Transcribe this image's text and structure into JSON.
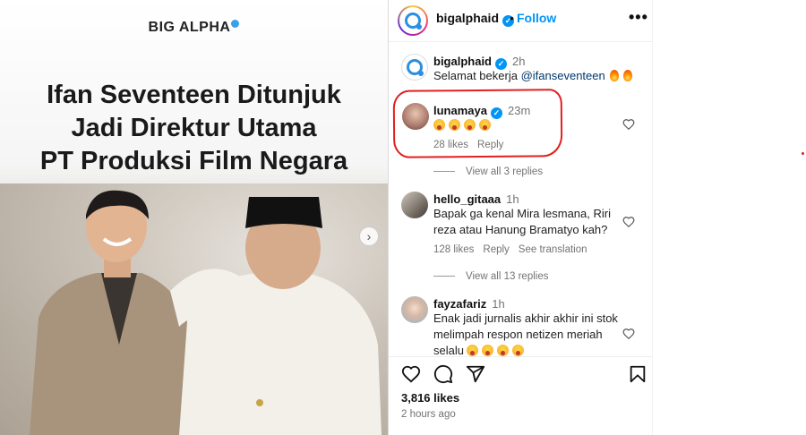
{
  "post_image": {
    "brand": "BIG ALPHA",
    "headline_lines": [
      "Ifan Seventeen Ditunjuk",
      "Jadi Direktur Utama",
      "PT Produksi Film Negara"
    ]
  },
  "header": {
    "username": "bigalphaid",
    "separator": "•",
    "follow_label": "Follow",
    "more_label": "•••"
  },
  "caption": {
    "username": "bigalphaid",
    "time": "2h",
    "text": "Selamat bekerja",
    "mention": "@ifanseventeen"
  },
  "comments": [
    {
      "username": "lunamaya",
      "verified": true,
      "time": "23m",
      "emoji_count": 4,
      "likes": "28 likes",
      "reply": "Reply",
      "view_replies": "View all 3 replies"
    },
    {
      "username": "hello_gitaaa",
      "time": "1h",
      "lines": [
        "Bapak ga kenal Mira lesmana, Riri",
        "reza atau Hanung Bramatyo kah?"
      ],
      "likes": "128 likes",
      "reply": "Reply",
      "see_translation": "See translation",
      "view_replies": "View all 13 replies"
    },
    {
      "username": "fayzafariz",
      "time": "1h",
      "lines": [
        "Enak jadi jurnalis akhir akhir ini stok",
        "melimpah respon netizen meriah",
        "selalu"
      ]
    }
  ],
  "footer": {
    "likes": "3,816 likes",
    "time": "2 hours ago"
  },
  "colors": {
    "link_blue": "#0095f6",
    "verified_blue": "#0095f6",
    "annotation_red": "#e02020",
    "muted_text": "#737373"
  },
  "icons": [
    "heart-icon",
    "comment-icon",
    "share-icon",
    "bookmark-icon",
    "more-icon",
    "verified-icon",
    "chevron-right-icon"
  ]
}
